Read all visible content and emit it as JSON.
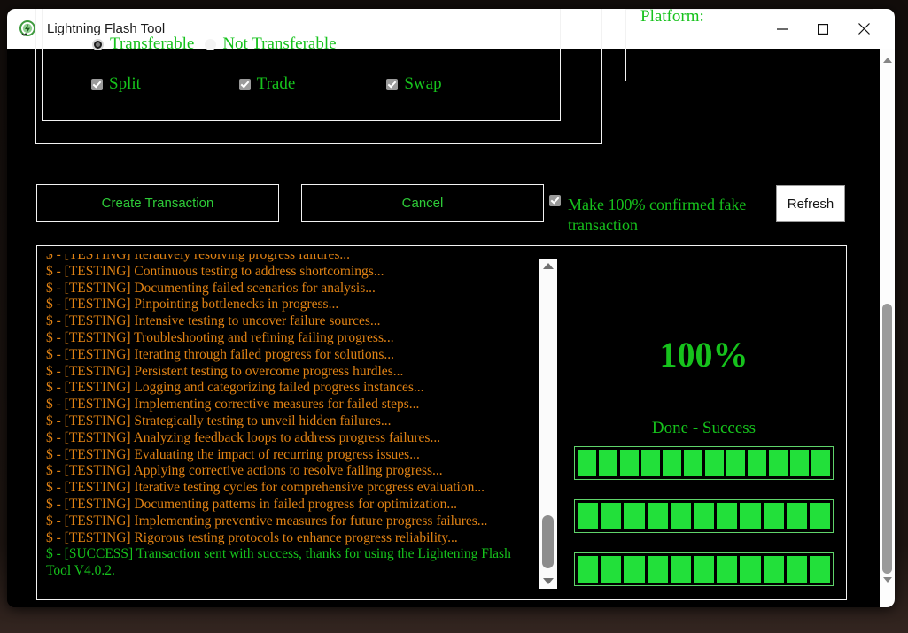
{
  "window": {
    "title": "Lightning Flash Tool",
    "icon": "app-logo-icon",
    "minimize_label": "–",
    "maximize_label": "□",
    "close_label": "×"
  },
  "form": {
    "clipped_header": "",
    "transfer_options": [
      {
        "label": "Transferable",
        "selected": true
      },
      {
        "label": "Not Transferable",
        "selected": false
      }
    ],
    "feature_checkboxes": [
      {
        "label": "Split",
        "checked": true
      },
      {
        "label": "Trade",
        "checked": true
      },
      {
        "label": "Swap",
        "checked": true
      }
    ],
    "platform_label": "Platform:"
  },
  "actions": {
    "create_label": "Create Transaction",
    "cancel_label": "Cancel",
    "refresh_label": "Refresh",
    "fake_checkbox": {
      "label": "Make 100% confirmed fake transaction",
      "checked": true
    }
  },
  "log": {
    "lines": [
      {
        "text": "$ - [TESTING] Iteratively resolving progress failures...",
        "type": "testing"
      },
      {
        "text": "$ - [TESTING] Continuous testing to address shortcomings...",
        "type": "testing"
      },
      {
        "text": "$ - [TESTING] Documenting failed scenarios for analysis...",
        "type": "testing"
      },
      {
        "text": "$ - [TESTING] Pinpointing bottlenecks in progress...",
        "type": "testing"
      },
      {
        "text": "$ - [TESTING] Intensive testing to uncover failure sources...",
        "type": "testing"
      },
      {
        "text": "$ - [TESTING] Troubleshooting and refining failing progress...",
        "type": "testing"
      },
      {
        "text": "$ - [TESTING] Iterating through failed progress for solutions...",
        "type": "testing"
      },
      {
        "text": "$ - [TESTING] Persistent testing to overcome progress hurdles...",
        "type": "testing"
      },
      {
        "text": "$ - [TESTING] Logging and categorizing failed progress instances...",
        "type": "testing"
      },
      {
        "text": "$ - [TESTING] Implementing corrective measures for failed steps...",
        "type": "testing"
      },
      {
        "text": "$ - [TESTING] Strategically testing to unveil hidden failures...",
        "type": "testing"
      },
      {
        "text": "$ - [TESTING] Analyzing feedback loops to address progress failures...",
        "type": "testing"
      },
      {
        "text": "$ - [TESTING] Evaluating the impact of recurring progress issues...",
        "type": "testing"
      },
      {
        "text": "$ - [TESTING] Applying corrective actions to resolve failing progress...",
        "type": "testing"
      },
      {
        "text": "$ - [TESTING] Iterative testing cycles for comprehensive progress evaluation...",
        "type": "testing"
      },
      {
        "text": "$ - [TESTING] Documenting patterns in failed progress for optimization...",
        "type": "testing"
      },
      {
        "text": "$ - [TESTING] Implementing preventive measures for future progress failures...",
        "type": "testing"
      },
      {
        "text": "$ - [TESTING] Rigorous testing protocols to enhance progress reliability...",
        "type": "testing"
      },
      {
        "text": "$ - [SUCCESS] Transaction sent with success, thanks for using the Lightening Flash Tool V4.0.2.",
        "type": "success"
      }
    ]
  },
  "progress": {
    "percent_label": "100%",
    "status_label": "Done - Success",
    "bars": [
      {
        "segments": 12,
        "filled": 12
      },
      {
        "segments": 11,
        "filled": 11
      },
      {
        "segments": 11,
        "filled": 11
      }
    ]
  },
  "colors": {
    "green_text": "#16c21c",
    "green_fill": "#22e03a",
    "log_orange": "#e08214",
    "background": "#000000",
    "border": "#f2f2f2"
  },
  "scrollbars": {
    "log_up_arrow": "triangle-up",
    "log_down_arrow": "triangle-down",
    "window_up_arrow": "triangle-up",
    "window_down_arrow": "triangle-down"
  }
}
